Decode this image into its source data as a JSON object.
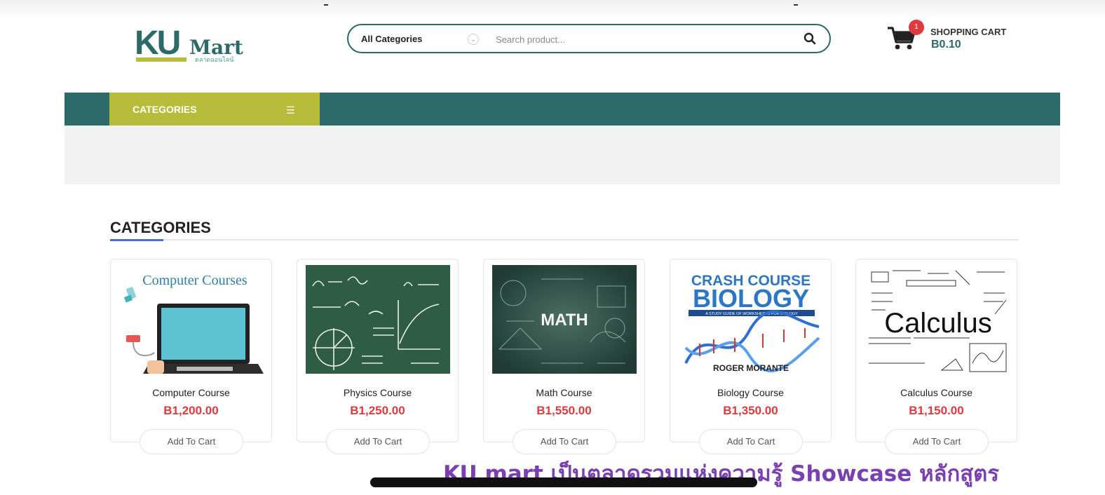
{
  "header": {
    "logo_text": "KU",
    "logo_text_2": "Mart",
    "logo_subtext": "ตลาดออนไลน์",
    "search": {
      "category_label": "All Categories",
      "placeholder": "Search product..."
    },
    "cart": {
      "badge_count": "1",
      "label": "SHOPPING CART",
      "total": "B0.10"
    }
  },
  "nav": {
    "categories_label": "CATEGORIES"
  },
  "section": {
    "title": "CATEGORIES"
  },
  "products": [
    {
      "name": "Computer Course",
      "price": "B1,200.00",
      "button": "Add To Cart",
      "image_text": "Computer Courses"
    },
    {
      "name": "Physics Course",
      "price": "B1,250.00",
      "button": "Add To Cart"
    },
    {
      "name": "Math Course",
      "price": "B1,550.00",
      "button": "Add To Cart",
      "image_text": "MATH"
    },
    {
      "name": "Biology Course",
      "price": "B1,350.00",
      "button": "Add To Cart",
      "image_text": {
        "line1": "CRASH COURSE",
        "line2": "BIOLOGY",
        "line3": "A STUDY GUIDE OF WORKSHEETS FOR BIOLOGY",
        "author": "ROGER MORANTE"
      }
    },
    {
      "name": "Calculus Course",
      "price": "B1,150.00",
      "button": "Add To Cart",
      "image_text": "Calculus"
    }
  ],
  "caption": "KU mart เป็นตลาดรวมแห่งความรู้ Showcase หลักสูตร",
  "colors": {
    "brand": "#2b6a68",
    "accent": "#b7bd3b",
    "price": "#e0393e",
    "caption": "#7a3fb0"
  }
}
